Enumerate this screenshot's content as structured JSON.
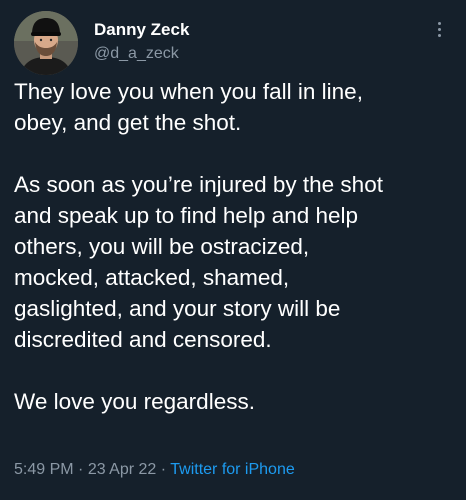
{
  "author": {
    "display_name": "Danny Zeck",
    "handle": "@d_a_zeck"
  },
  "tweet": {
    "paragraphs": [
      "They love you when you fall in line,\nobey, and get the shot.",
      "As soon as you’re injured by the shot\nand speak up to find help and help\nothers, you will be ostracized,\nmocked, attacked, shamed,\ngaslighted, and your story will be\ndiscredited and censored.",
      "We love you regardless."
    ]
  },
  "meta": {
    "time": "5:49 PM",
    "separator": " · ",
    "date": "23 Apr 22",
    "source": "Twitter for iPhone"
  },
  "icons": {
    "more": "more-vertical-icon",
    "avatar": "profile-photo"
  },
  "colors": {
    "background": "#15202b",
    "primary_text": "#ffffff",
    "secondary_text": "#8b98a5",
    "link": "#1d9bf0"
  }
}
